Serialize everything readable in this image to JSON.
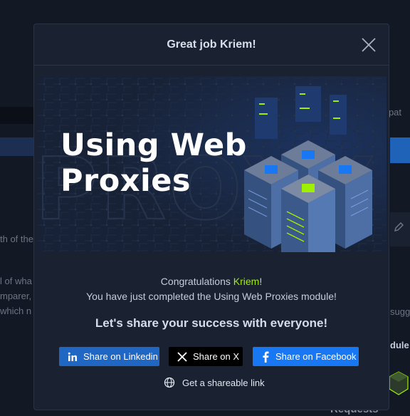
{
  "modal": {
    "title": "Great job Kriem!",
    "banner_title_line1": "Using Web",
    "banner_title_line2": "Proxies",
    "banner_watermark": "PROXY",
    "congrats_prefix": "Congratulations ",
    "username": "Kriem",
    "congrats_suffix": "!",
    "completed_message": "You have just completed the Using Web Proxies module!",
    "share_heading": "Let's share your success with everyone!",
    "buttons": {
      "linkedin": "Share on Linkedin",
      "x": "Share on X",
      "facebook": "Share on Facebook"
    },
    "shareable_link": "Get a shareable link"
  },
  "background": {
    "text_right_1": "r pat",
    "text_left_1": "th of the",
    "text_left_2": "l of wha",
    "text_left_3": "mparer,",
    "text_left_4": "which n",
    "text_right_2": "sugg",
    "text_right_3": "dule",
    "requests": "Requests"
  },
  "colors": {
    "accent_green": "#9fef00",
    "linkedin_blue": "#1f67c3",
    "facebook_blue": "#1877f2",
    "modal_bg": "#1a2232"
  }
}
